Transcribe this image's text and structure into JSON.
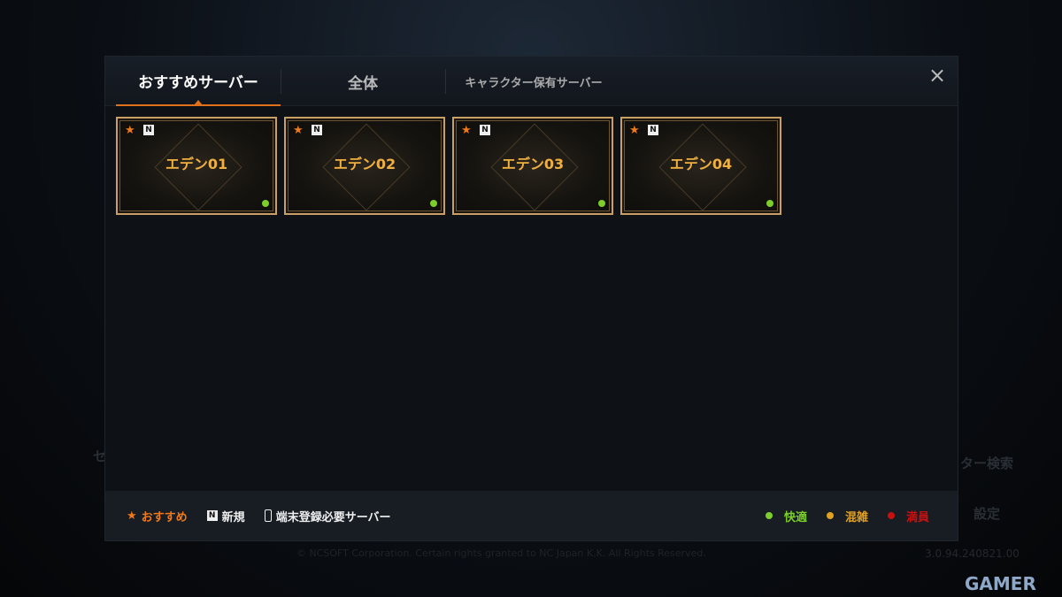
{
  "background": {
    "left_text": "セ",
    "right_search": "ター検索",
    "right_settings": "設定",
    "copyright": "© NCSOFT Corporation. Certain rights granted to NC Japan K.K. All Rights Reserved.",
    "version": "3.0.94.240821.00",
    "watermark": "ONLINE GAMER"
  },
  "tabs": [
    {
      "label": "おすすめサーバー",
      "active": true
    },
    {
      "label": "全体"
    },
    {
      "label": "キャラクター保有サーバー"
    }
  ],
  "close_icon": "×",
  "servers": [
    {
      "name": "エデン01",
      "recommended": true,
      "new": "N",
      "status": "快適"
    },
    {
      "name": "エデン02",
      "recommended": true,
      "new": "N",
      "status": "快適"
    },
    {
      "name": "エデン03",
      "recommended": true,
      "new": "N",
      "status": "快適"
    },
    {
      "name": "エデン04",
      "recommended": true,
      "new": "N",
      "status": "快適"
    }
  ],
  "legend": {
    "recommended": "おすすめ",
    "new_badge": "N",
    "new": "新規",
    "device": "端末登録必要サーバー"
  },
  "status_legend": [
    {
      "label": "快適",
      "color": "#7ccf2a"
    },
    {
      "label": "混雑",
      "color": "#e0a020"
    },
    {
      "label": "満員",
      "color": "#c81010"
    }
  ],
  "colors": {
    "accent": "#e0701a",
    "card_border": "#c9a064",
    "server_name": "#f0b040"
  }
}
